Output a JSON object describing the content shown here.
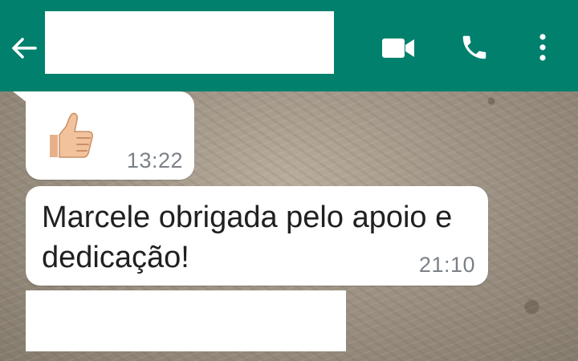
{
  "header": {
    "background": "#00806d",
    "back_icon": "arrow-left-icon",
    "contact_name": "",
    "video_icon": "videocam-icon",
    "call_icon": "phone-icon",
    "menu_icon": "more-vert-icon"
  },
  "messages": [
    {
      "kind": "emoji",
      "icon": "thumbs-up-icon",
      "time": "13:22"
    },
    {
      "kind": "text",
      "text": "Marcele obrigada pelo apoio e dedicação!",
      "time": "21:10"
    },
    {
      "kind": "redacted",
      "text": ""
    }
  ]
}
